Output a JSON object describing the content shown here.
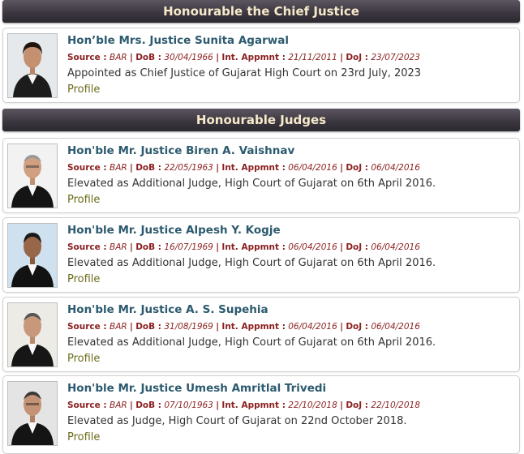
{
  "chief": {
    "header": "Honourable the Chief Justice",
    "judge": {
      "name": "Hon’ble Mrs. Justice Sunita Agarwal",
      "source_label": "Source :",
      "source": "BAR",
      "dob_label": "DoB :",
      "dob": "30/04/1966",
      "appt_label": "Int. Appmnt :",
      "appt": "21/11/2011",
      "doj_label": "DoJ :",
      "doj": "23/07/2023",
      "description": "Appointed as Chief Justice of Gujarat High Court on 23rd July, 2023",
      "profile": "Profile"
    }
  },
  "judges_section": {
    "header": "Honourable Judges",
    "judges": [
      {
        "name": "Hon'ble Mr. Justice Biren A. Vaishnav",
        "source_label": "Source :",
        "source": "BAR",
        "dob_label": "DoB :",
        "dob": "22/05/1963",
        "appt_label": "Int. Appmnt :",
        "appt": "06/04/2016",
        "doj_label": "DoJ :",
        "doj": "06/04/2016",
        "description": "Elevated as Additional Judge, High Court of Gujarat on 6th April 2016.",
        "profile": "Profile"
      },
      {
        "name": "Hon'ble Mr. Justice Alpesh Y. Kogje",
        "source_label": "Source :",
        "source": "BAR",
        "dob_label": "DoB :",
        "dob": "16/07/1969",
        "appt_label": "Int. Appmnt :",
        "appt": "06/04/2016",
        "doj_label": "DoJ :",
        "doj": "06/04/2016",
        "description": "Elevated as Additional Judge, High Court of Gujarat on 6th April 2016.",
        "profile": "Profile"
      },
      {
        "name": "Hon'ble Mr. Justice A. S. Supehia",
        "source_label": "Source :",
        "source": "BAR",
        "dob_label": "DoB :",
        "dob": "31/08/1969",
        "appt_label": "Int. Appmnt :",
        "appt": "06/04/2016",
        "doj_label": "DoJ :",
        "doj": "06/04/2016",
        "description": "Elevated as Additional Judge, High Court of Gujarat on 6th April 2016.",
        "profile": "Profile"
      },
      {
        "name": "Hon'ble Mr. Justice Umesh Amritlal Trivedi",
        "source_label": "Source :",
        "source": "BAR",
        "dob_label": "DoB :",
        "dob": "07/10/1963",
        "appt_label": "Int. Appmnt :",
        "appt": "22/10/2018",
        "doj_label": "DoJ :",
        "doj": "22/10/2018",
        "description": "Elevated as Judge, High Court of Gujarat on 22nd October 2018.",
        "profile": "Profile"
      }
    ]
  },
  "colors": {
    "header_text": "#f7eacb",
    "header_bg": "#3c3740",
    "name": "#2c5a6e",
    "meta": "#8b1f1f",
    "profile": "#6b6b1a"
  }
}
